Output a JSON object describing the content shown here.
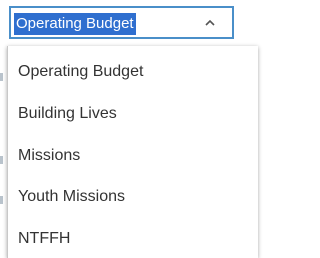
{
  "select": {
    "selected_value": "Operating Budget"
  },
  "dropdown": {
    "options": [
      {
        "label": "Operating Budget"
      },
      {
        "label": "Building Lives"
      },
      {
        "label": "Missions"
      },
      {
        "label": "Youth Missions"
      },
      {
        "label": "NTFFH"
      }
    ]
  },
  "colors": {
    "focus_border": "#4a8fc9",
    "selection_highlight": "#2f6fcf",
    "option_text": "#333333"
  },
  "icons": {
    "toggle": "chevron-up-icon"
  }
}
